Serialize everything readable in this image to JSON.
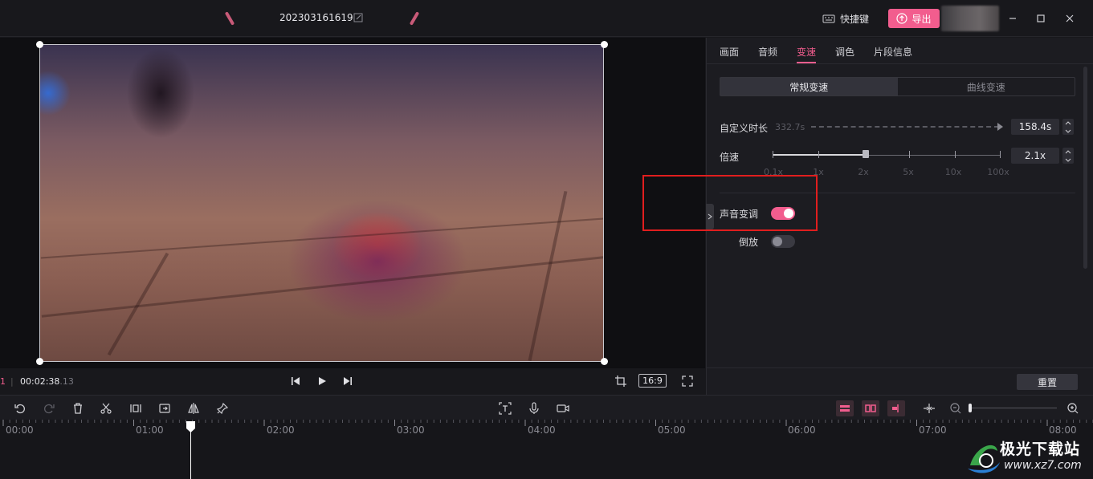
{
  "app": {
    "project_title": "202303161619",
    "shortcut_label": "快捷键",
    "export_label": "导出",
    "accent": "#f25d8e"
  },
  "player": {
    "timecode_prefix": "1",
    "timecode": "00:02:38",
    "timecode_frames": ".13",
    "aspect_ratio": "16:9"
  },
  "panel": {
    "tabs": [
      "画面",
      "音频",
      "变速",
      "调色",
      "片段信息"
    ],
    "active_tab": "变速",
    "modes": [
      "常规变速",
      "曲线变速"
    ],
    "active_mode": "常规变速",
    "custom_duration_label": "自定义时长",
    "original_duration": "332.7s",
    "custom_duration_value": "158.4s",
    "speed_label": "倍速",
    "speed_value": "2.1x",
    "speed_ticks": [
      "0.1x",
      "1x",
      "2x",
      "5x",
      "10x",
      "100x"
    ],
    "pitch_label": "声音变调",
    "pitch_on": true,
    "reverse_label": "倒放",
    "reverse_on": false,
    "reset_label": "重置"
  },
  "timeline": {
    "time_labels": [
      "00:00",
      "01:00",
      "02:00",
      "03:00",
      "04:00",
      "05:00",
      "06:00",
      "07:00",
      "08:00"
    ]
  },
  "watermark": {
    "text": "极光下载站",
    "url": "www.xz7.com"
  },
  "icons": {
    "edit": "pencil-icon",
    "keyboard": "keyboard-icon",
    "export": "upload-icon",
    "minimize": "minimize-icon",
    "maximize": "maximize-icon",
    "close": "close-icon"
  }
}
